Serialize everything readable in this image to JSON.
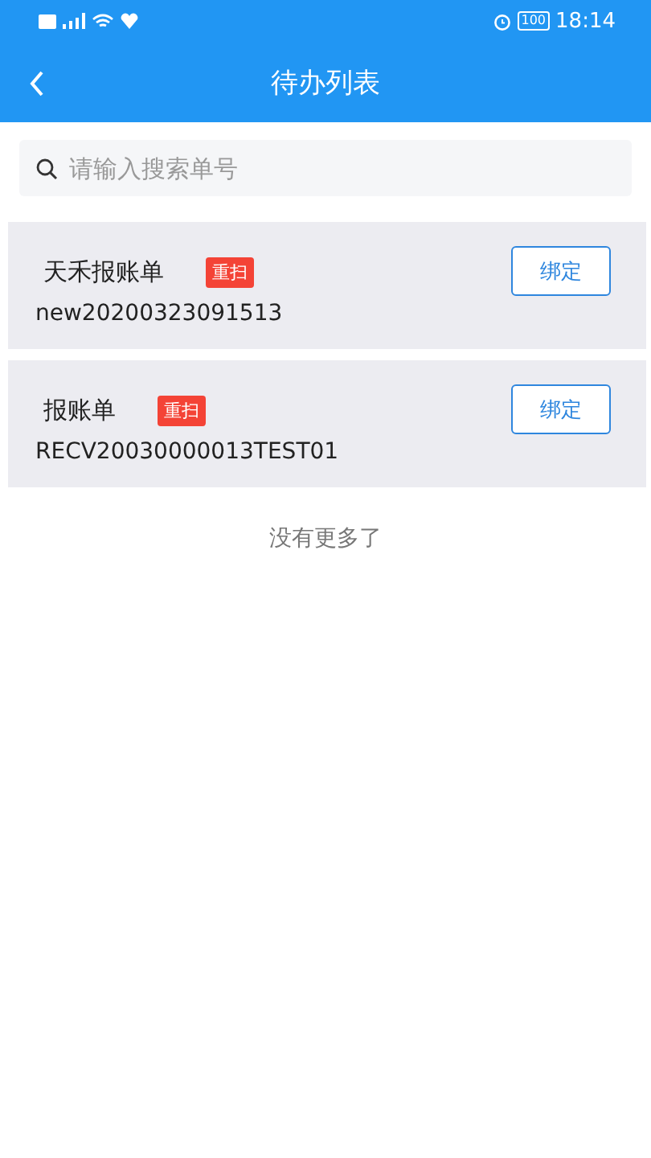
{
  "status_bar": {
    "battery": "100",
    "time": "18:14"
  },
  "header": {
    "title": "待办列表"
  },
  "search": {
    "placeholder": "请输入搜索单号"
  },
  "items": [
    {
      "title": "天禾报账单",
      "badge": "重扫",
      "number": "new20200323091513",
      "button": "绑定"
    },
    {
      "title": "报账单",
      "badge": "重扫",
      "number": "RECV20030000013TEST01",
      "button": "绑定"
    }
  ],
  "footer": "没有更多了"
}
